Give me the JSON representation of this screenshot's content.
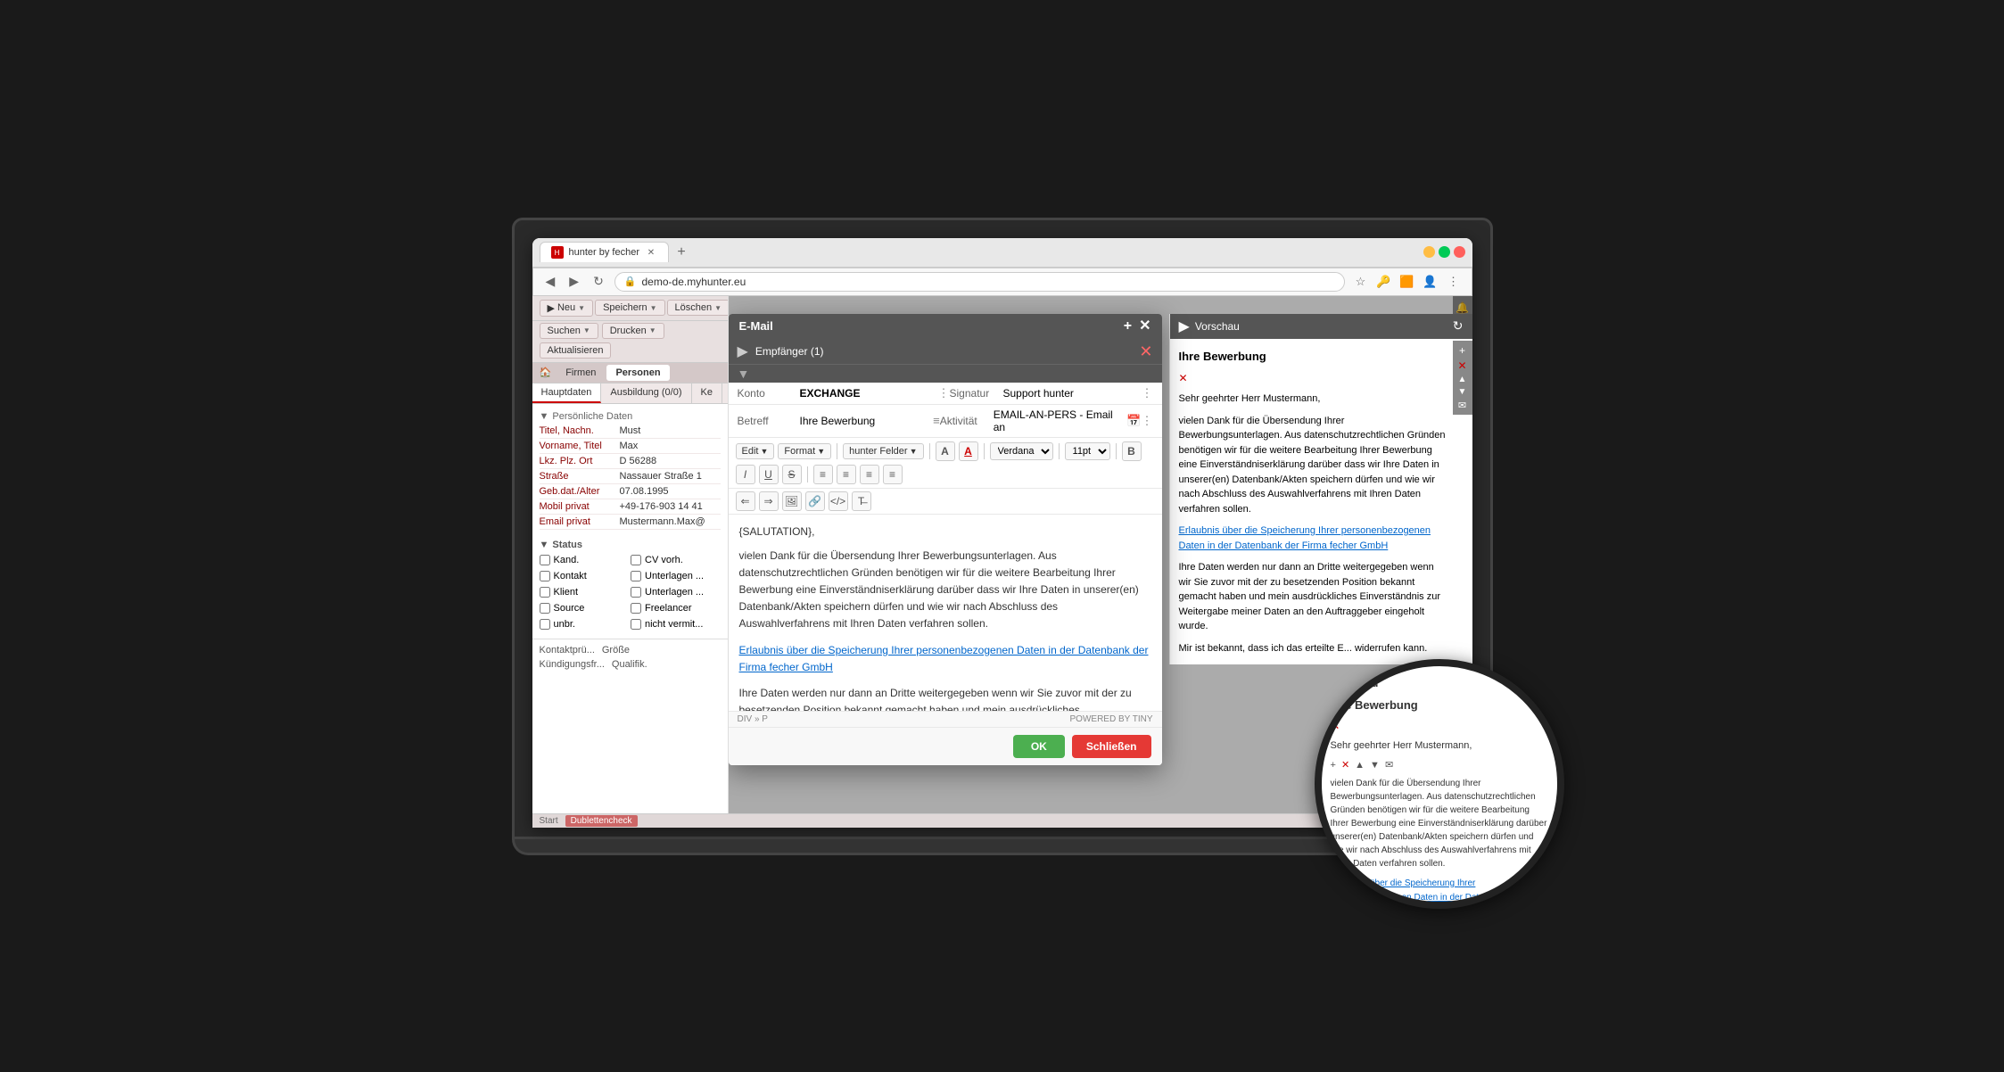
{
  "browser": {
    "tab_title": "hunter by fecher",
    "tab_favicon": "H",
    "url": "demo-de.myhunter.eu",
    "nav_back": "◀",
    "nav_forward": "▶",
    "nav_refresh": "↻"
  },
  "toolbar": {
    "neu_label": "Neu",
    "speichern_label": "Speichern",
    "loeschen_label": "Löschen",
    "suchen_label": "Suchen",
    "drucken_label": "Drucken",
    "aktualisieren_label": "Aktualisieren",
    "start_label": "Start"
  },
  "nav": {
    "firmen_label": "Firmen",
    "personen_label": "Personen"
  },
  "tabs": {
    "hauptdaten_label": "Hauptdaten",
    "ausbildung_label": "Ausbildung (0/0)",
    "ke_label": "Ke"
  },
  "sidebar": {
    "section_title": "Persönliche Daten",
    "fields": [
      {
        "label": "Titel, Nachn.",
        "value": "Must"
      },
      {
        "label": "Vorname, Titel",
        "value": "Max"
      },
      {
        "label": "Lkz. Plz. Ort",
        "value": "D  56288"
      },
      {
        "label": "Straße",
        "value": "Nassauer Straße 1"
      },
      {
        "label": "Geb.dat./Alter",
        "value": "07.08.1995"
      },
      {
        "label": "Mobil privat",
        "value": "+49-176-903 14 41"
      },
      {
        "label": "Email privat",
        "value": "Mustermann.Max@"
      }
    ],
    "status": {
      "title": "Status",
      "checkboxes": [
        {
          "label": "Kand.",
          "checked": false
        },
        {
          "label": "CV vorh.",
          "checked": false
        },
        {
          "label": "Kontakt",
          "checked": false
        },
        {
          "label": "Unterlagen ...",
          "checked": false
        },
        {
          "label": "Klient",
          "checked": false
        },
        {
          "label": "Unterlagen ...",
          "checked": false
        },
        {
          "label": "Source",
          "checked": false
        },
        {
          "label": "Freelancer",
          "checked": false
        },
        {
          "label": "unbr.",
          "checked": false
        },
        {
          "label": "nicht vermit...",
          "checked": false
        }
      ]
    }
  },
  "email_modal": {
    "title": "E-Mail",
    "recipients_label": "Empfänger (1)",
    "konto_label": "Konto",
    "konto_value": "EXCHANGE",
    "signatur_label": "Signatur",
    "signatur_value": "Support hunter",
    "betreff_label": "Betreff",
    "betreff_value": "Ihre Bewerbung",
    "aktivitaet_label": "Aktivität",
    "aktivitaet_value": "EMAIL-AN-PERS - Email an",
    "toolbar": {
      "edit_label": "Edit",
      "format_label": "Format",
      "felder_label": "hunter Felder",
      "font_label": "Verdana",
      "size_label": "11pt"
    },
    "body_salutation": "{SALUTATION},",
    "body_p1": "vielen Dank für die Übersendung Ihrer Bewerbungsunterlagen. Aus datenschutzrechtlichen Gründen benötigen wir für die weitere Bearbeitung Ihrer Bewerbung eine Einverständniserklärung darüber dass wir Ihre Daten in unserer(en) Datenbank/Akten speichern dürfen und wie wir nach Abschluss des Auswahlverfahrens mit Ihren Daten verfahren sollen.",
    "body_link": "Erlaubnis über die Speicherung Ihrer personenbezogenen Daten in der  Datenbank der Firma fecher GmbH",
    "body_p2": "Ihre Daten werden nur dann an Dritte weitergegeben wenn wir Sie zuvor mit der zu besetzenden Position bekannt gemacht haben und mein ausdrückliches Einverständnis zur Weitergabe meiner Daten an den Auftraggeber eingeholt wurde.",
    "statusbar_path": "DIV » P",
    "statusbar_powered": "POWERED BY TINY",
    "btn_ok": "OK",
    "btn_close": "Schließen"
  },
  "preview": {
    "title": "Vorschau",
    "email_title": "Ihre Bewerbung",
    "salutation": "Sehr geehrter Herr Mustermann,",
    "body_intro": "vielen Dank für die Übersendung Ihrer Bewerbungsunterlagen. Aus datenschutzrechtlichen Gründen benötigen wir für die weitere Bearbeitung Ihrer Bewerbung eine Einverständniserklärung darüber dass wir Ihre Daten in unserer(en) Datenbank/Akten speichern dürfen und wie wir nach Abschluss des Auswahlverfahrens mit Ihren Daten verfahren sollen.",
    "link_text": "Erlaubnis über die Speicherung Ihrer personenbezogenen Daten in der  Datenbank der Firma fecher GmbH",
    "body_p2": "Ihre Daten werden nur dann an Dritte weitergegeben wenn wir Sie zuvor mit der zu besetzenden Position bekannt gemacht haben und mein ausdrückliches Einverständnis zur Weitergabe meiner Daten an den Auftraggeber eingeholt wurde.",
    "body_p3": "Mir ist bekannt, dass ich das erteilte E... widerrufen kann."
  },
  "magnifier": {
    "title": "Ihre Bewerbung",
    "salutation": "Sehr geehrter Herr Mustermann,",
    "body": "vielen Dank für die Übersendung Ihrer Bewerbungsunterlagen. Aus datenschutzrechtlichen Gründen benötigen wir für die weitere Bearbeitung Ihrer Bewerbung eine Einverständniserklärung darüber unserer(en) Datenbank/Akten speichern dürfen und wie wir nach Abschluss des Auswahlverfahrens mit Ihren Daten verfahren sollen.",
    "link_text": "Erlaubnis über die Speicherung Ihrer personenbezogenen Daten in der  Datenbank der"
  },
  "bottom_list": {
    "kontaktpru_label": "Kontaktprü...",
    "grosse_label": "Größe",
    "qualif_label": "Qualifik.",
    "kundigung_label": "Kündigungsfr...",
    "duplicate_label": "Dublettencheck"
  }
}
